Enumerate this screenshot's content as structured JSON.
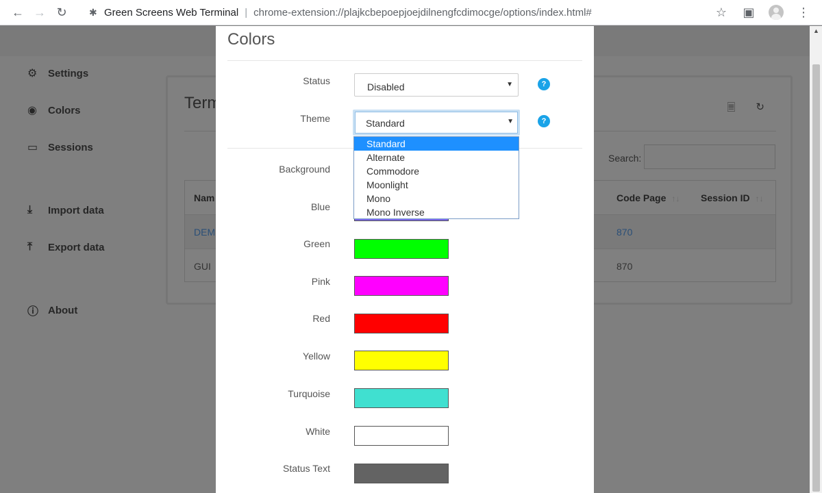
{
  "browser": {
    "site_title": "Green Screens Web Terminal",
    "url": "chrome-extension://plajkcbepoepjoejdilnengfcdimocge/options/index.html#"
  },
  "sidebar": {
    "items": [
      {
        "label": "Settings",
        "icon": "gear-icon"
      },
      {
        "label": "Colors",
        "icon": "eye-icon"
      },
      {
        "label": "Sessions",
        "icon": "monitor-icon"
      },
      {
        "label": "Import data",
        "icon": "download-icon"
      },
      {
        "label": "Export data",
        "icon": "upload-icon"
      },
      {
        "label": "About",
        "icon": "info-icon"
      }
    ]
  },
  "card": {
    "title": "Term",
    "search_label": "Search:",
    "columns": {
      "name": "Nam",
      "code_page": "Code Page",
      "session_id": "Session ID"
    },
    "rows": [
      {
        "name": "DEM",
        "code_page": "870"
      },
      {
        "name": "GUI",
        "code_page": "870"
      }
    ]
  },
  "modal": {
    "title": "Colors",
    "status": {
      "label": "Status",
      "value": "Disabled"
    },
    "theme": {
      "label": "Theme",
      "value": "Standard"
    },
    "theme_options": [
      "Standard",
      "Alternate",
      "Commodore",
      "Moonlight",
      "Mono",
      "Mono Inverse"
    ],
    "selected_option": "Standard",
    "color_fields": [
      {
        "label": "Background",
        "color": "#000000"
      },
      {
        "label": "Blue",
        "color": "#7b68ee"
      },
      {
        "label": "Green",
        "color": "#00ff00"
      },
      {
        "label": "Pink",
        "color": "#ff00ff"
      },
      {
        "label": "Red",
        "color": "#ff0000"
      },
      {
        "label": "Yellow",
        "color": "#ffff00"
      },
      {
        "label": "Turquoise",
        "color": "#40e0d0"
      },
      {
        "label": "White",
        "color": "#ffffff"
      },
      {
        "label": "Status Text",
        "color": "#636363"
      }
    ]
  },
  "help_badge": "?"
}
